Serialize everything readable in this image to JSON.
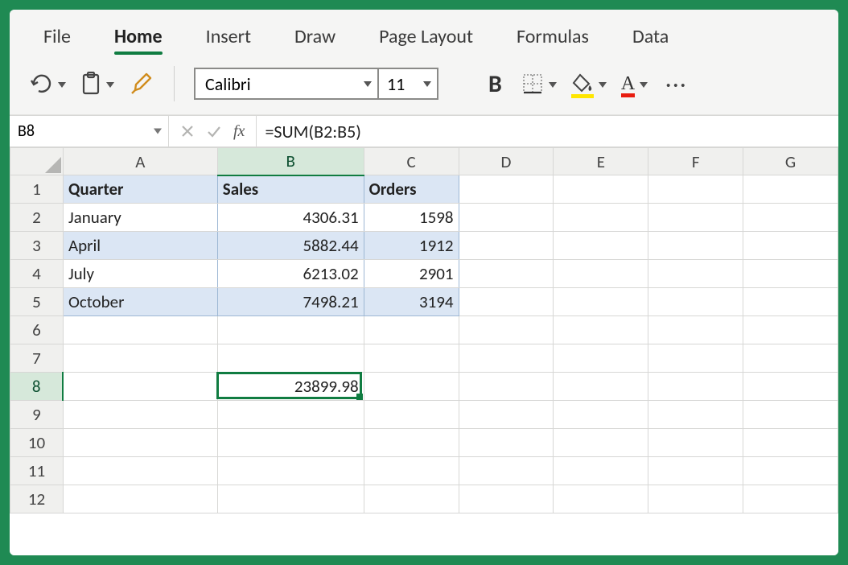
{
  "tabs": {
    "file": "File",
    "home": "Home",
    "insert": "Insert",
    "draw": "Draw",
    "page_layout": "Page Layout",
    "formulas": "Formulas",
    "data": "Data",
    "active": "home"
  },
  "toolbar": {
    "font_name": "Calibri",
    "font_size": "11",
    "bold_label": "B",
    "colors": {
      "fill": "#ffe600",
      "font": "#e81c0f"
    }
  },
  "formula_bar": {
    "name_box": "B8",
    "fx_label": "fx",
    "formula": "=SUM(B2:B5)"
  },
  "columns": [
    "A",
    "B",
    "C",
    "D",
    "E",
    "F",
    "G"
  ],
  "row_labels": [
    "1",
    "2",
    "3",
    "4",
    "5",
    "6",
    "7",
    "8",
    "9",
    "10",
    "11",
    "12"
  ],
  "selected_col": "B",
  "selected_row": "8",
  "table": {
    "headers": {
      "A": "Quarter",
      "B": "Sales",
      "C": "Orders"
    },
    "rows": [
      {
        "A": "January",
        "B": "4306.31",
        "C": "1598"
      },
      {
        "A": "April",
        "B": "5882.44",
        "C": "1912"
      },
      {
        "A": "July",
        "B": "6213.02",
        "C": "2901"
      },
      {
        "A": "October",
        "B": "7498.21",
        "C": "3194"
      }
    ]
  },
  "result_cell": {
    "row": "8",
    "col": "B",
    "value": "23899.98"
  },
  "chart_data": {
    "type": "table",
    "title": "",
    "columns": [
      "Quarter",
      "Sales",
      "Orders"
    ],
    "rows": [
      [
        "January",
        4306.31,
        1598
      ],
      [
        "April",
        5882.44,
        1912
      ],
      [
        "July",
        6213.02,
        2901
      ],
      [
        "October",
        7498.21,
        3194
      ]
    ],
    "aggregate": {
      "label": "SUM(Sales)",
      "value": 23899.98
    }
  }
}
